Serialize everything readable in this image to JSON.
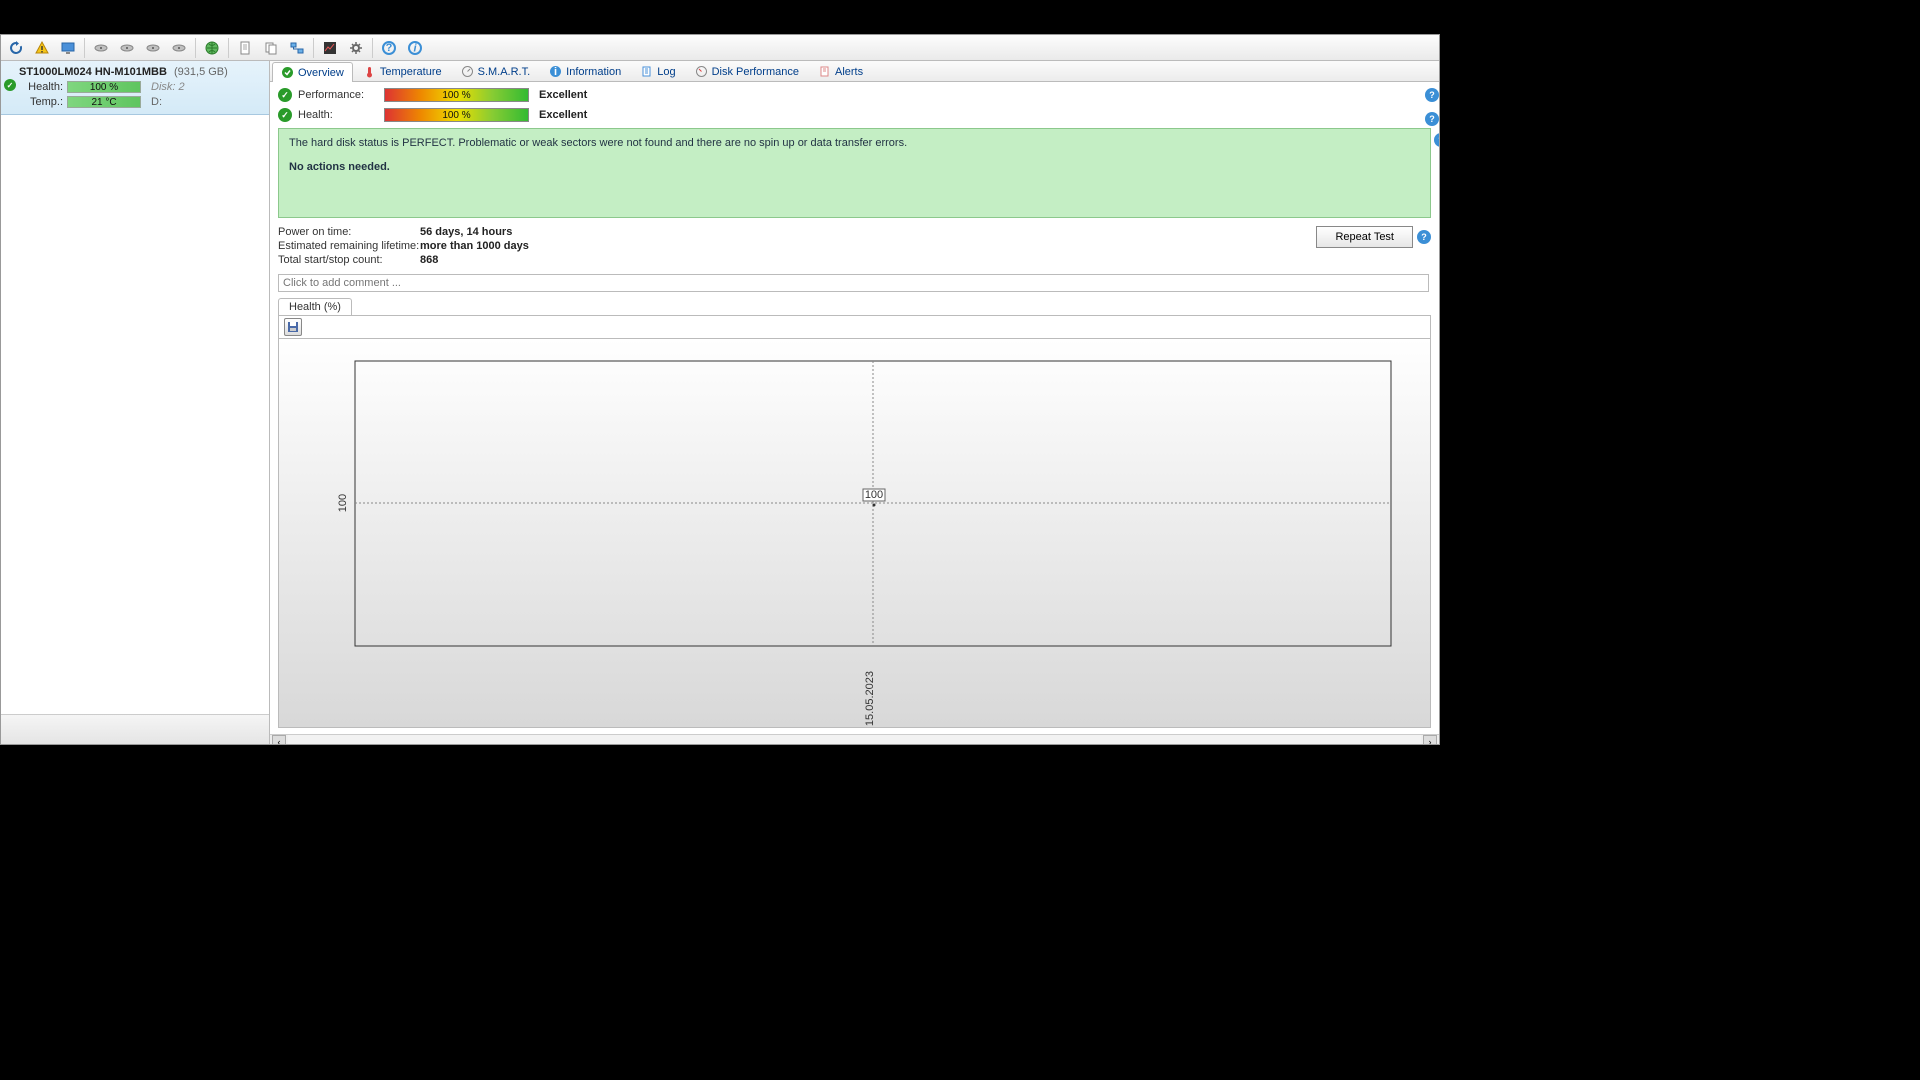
{
  "sidebar": {
    "disk_model": "ST1000LM024 HN-M101MBB",
    "disk_size": "(931,5 GB)",
    "health_label": "Health:",
    "health_value": "100 %",
    "disk_meta": "Disk: 2",
    "temp_label": "Temp.:",
    "temp_value": "21 °C",
    "drive_letter": "D:"
  },
  "tabs": {
    "overview": "Overview",
    "temperature": "Temperature",
    "smart": "S.M.A.R.T.",
    "information": "Information",
    "log": "Log",
    "disk_performance": "Disk Performance",
    "alerts": "Alerts"
  },
  "metrics": {
    "performance_label": "Performance:",
    "performance_value": "100 %",
    "performance_result": "Excellent",
    "health_label": "Health:",
    "health_value": "100 %",
    "health_result": "Excellent"
  },
  "status": {
    "text": "The hard disk status is PERFECT. Problematic or weak sectors were not found and there are no spin up or data transfer errors.",
    "action": "No actions needed."
  },
  "stats": {
    "power_on_label": "Power on time:",
    "power_on_value": "56 days, 14 hours",
    "lifetime_label": "Estimated remaining lifetime:",
    "lifetime_value": "more than 1000 days",
    "startstop_label": "Total start/stop count:",
    "startstop_value": "868"
  },
  "repeat_test": "Repeat Test",
  "comment_placeholder": "Click to add comment ...",
  "chart_tab": "Health (%)",
  "chart_data": {
    "type": "scatter",
    "title": "Health (%)",
    "ylabel": "",
    "xlabel": "",
    "y_ticks": [
      100
    ],
    "x_ticks": [
      "15.05.2023"
    ],
    "series": [
      {
        "name": "Health",
        "points": [
          {
            "x": "15.05.2023",
            "y": 100
          }
        ]
      }
    ]
  }
}
